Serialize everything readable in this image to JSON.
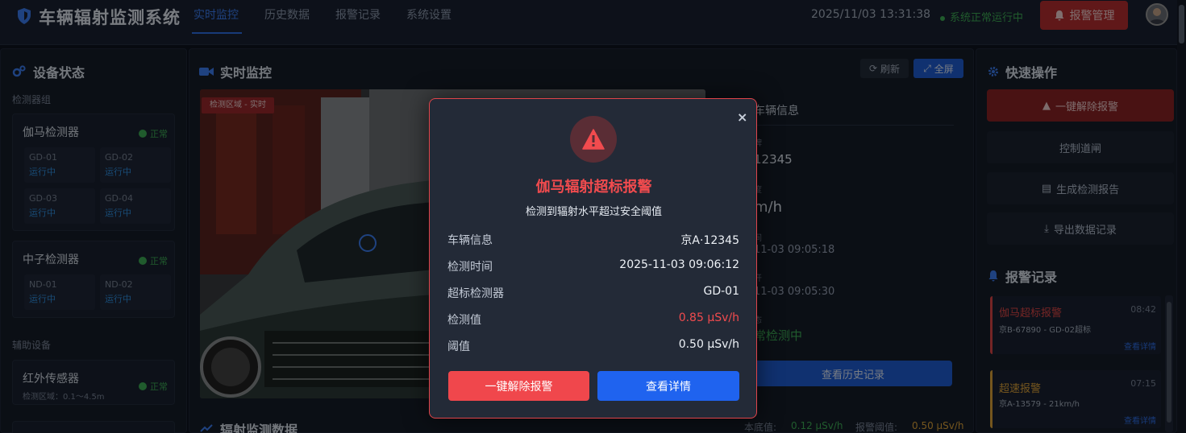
{
  "header": {
    "app_title": "车辆辐射监测系统",
    "nav": [
      "实时监控",
      "历史数据",
      "报警记录",
      "系统设置"
    ],
    "datetime": "2025/11/03 13:31:38",
    "system_status": "系统正常运行中",
    "alarm_button": "报警管理"
  },
  "left": {
    "title": "设备状态",
    "group_label": "检测器组",
    "gamma": {
      "title": "伽马检测器",
      "status": "正常",
      "detectors": [
        {
          "id": "GD-01",
          "state": "运行中"
        },
        {
          "id": "GD-02",
          "state": "运行中"
        },
        {
          "id": "GD-03",
          "state": "运行中"
        },
        {
          "id": "GD-04",
          "state": "运行中"
        }
      ]
    },
    "neutron": {
      "title": "中子检测器",
      "status": "正常",
      "detectors": [
        {
          "id": "ND-01",
          "state": "运行中"
        },
        {
          "id": "ND-02",
          "state": "运行中"
        }
      ]
    },
    "aux_label": "辅助设备",
    "infrared": {
      "title": "红外传感器",
      "status": "正常",
      "range": "检测区域：0.1～4.5m"
    }
  },
  "center": {
    "title": "实时监控",
    "refresh": "刷新",
    "fullscreen": "全屏",
    "video_tag": "检测区域 - 实时",
    "vehicle_info_title": "车辆信息",
    "vehicle_fragments": [
      "牌",
      "12345",
      "度",
      "m/h",
      "间",
      "11-03 09:05:18",
      "开",
      "11-03 09:05:30",
      "态",
      "常检测中"
    ],
    "history_button": "查看历史记录",
    "radiation_title": "辐射监测数据",
    "baseline_label": "本底值:",
    "baseline_value": "0.12 μSv/h",
    "threshold_label": "报警阈值:",
    "threshold_value": "0.50 μSv/h"
  },
  "right": {
    "quick_title": "快速操作",
    "buttons": [
      "一键解除报警",
      "控制道闸",
      "生成检测报告",
      "导出数据记录"
    ],
    "alarm_title": "报警记录",
    "alarms": [
      {
        "title": "伽马超标报警",
        "time": "08:42",
        "desc": "京B-67890 - GD-02超标",
        "link": "查看详情",
        "color": "#e04848"
      },
      {
        "title": "超速报警",
        "time": "07:15",
        "desc": "京A-13579 - 21km/h",
        "link": "查看详情",
        "color": "#e0a53a"
      }
    ]
  },
  "modal": {
    "title": "伽马辐射超标报警",
    "subtitle": "检测到辐射水平超过安全阈值",
    "rows": [
      {
        "label": "车辆信息",
        "value": "京A·12345"
      },
      {
        "label": "检测时间",
        "value": "2025-11-03 09:06:12"
      },
      {
        "label": "超标检测器",
        "value": "GD-01"
      },
      {
        "label": "检测值",
        "value": "0.85 μSv/h"
      },
      {
        "label": "阈值",
        "value": "0.50 μSv/h"
      }
    ],
    "dismiss_button": "一键解除报警",
    "detail_button": "查看详情",
    "close": "×"
  },
  "colors": {
    "accent": "#2f6fe8",
    "danger": "#e0444a",
    "ok": "#3fae56",
    "warn": "#e0a53a"
  }
}
